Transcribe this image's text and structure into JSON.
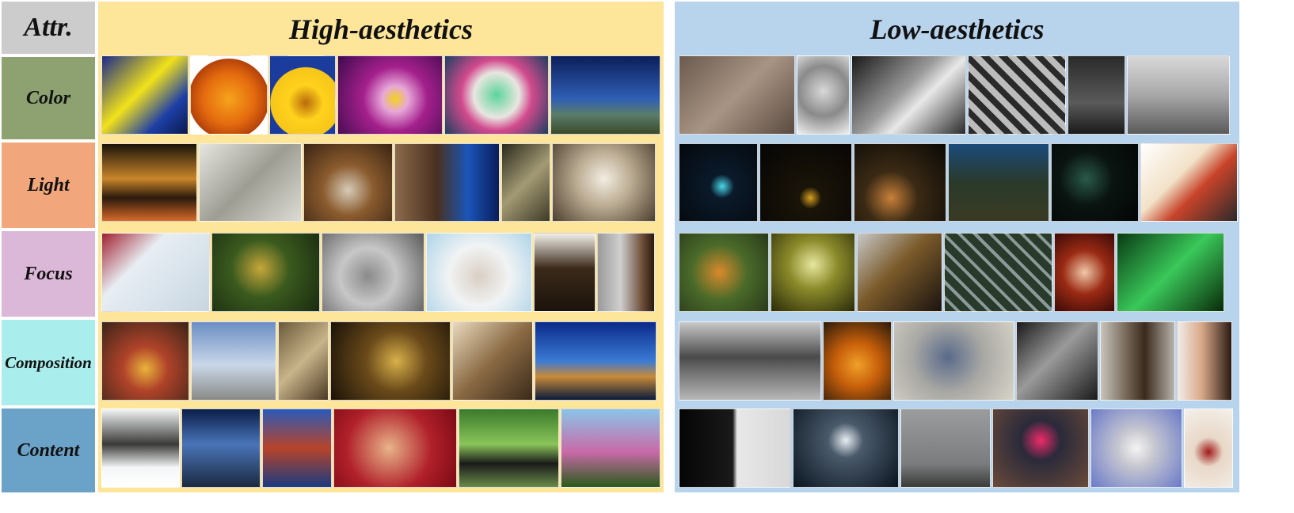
{
  "corner_label": "Attr.",
  "columns": {
    "high": {
      "title": "High-aesthetics",
      "bg": "#fde59a"
    },
    "low": {
      "title": "Low-aesthetics",
      "bg": "#b8d4ec"
    }
  },
  "rows": [
    {
      "label": "Color",
      "bg": "#8da171"
    },
    {
      "label": "Light",
      "bg": "#f2a67b"
    },
    {
      "label": "Focus",
      "bg": "#dbb7d8"
    },
    {
      "label": "Composition",
      "bg": "#a9eeec"
    },
    {
      "label": "Content",
      "bg": "#6ba2c7"
    }
  ],
  "photos": {
    "high": [
      [
        {
          "name": "abstract-swirl-photo",
          "fill": "linear-gradient(135deg,#1a2a8a 0%,#f2e21a 45%,#1d3fa6 75%,#0b1a4d 100%)"
        },
        {
          "name": "orange-flower-photo",
          "fill": "radial-gradient(circle at 50% 55%,#f6a41b 0%,#e46a0e 45%,#b4420a 70%,#ffffff 71%)"
        },
        {
          "name": "yellow-daisy-photo",
          "fill": "radial-gradient(circle at 55% 60%,#b86a0b 0%,#ffd21c 30%,#f6c51a 60%,#1b3c9c 61%)"
        },
        {
          "name": "purple-pansy-photo",
          "fill": "radial-gradient(circle at 55% 55%,#f3d21d 0%,#e7a7d9 18%,#a4208c 45%,#3d0b4d 100%)"
        },
        {
          "name": "paper-roll-photo",
          "fill": "radial-gradient(circle at 50% 50%,#5bd49a 0%,#e8e6e0 35%,#d24a8d 55%,#1d3f61 100%)"
        },
        {
          "name": "night-lake-boat-photo",
          "fill": "linear-gradient(180deg,#0b1e5a 0%,#2f5fb5 55%,#5a7d6b 75%,#3c4a2a 100%)"
        }
      ],
      [
        {
          "name": "night-riverwalk-photo",
          "fill": "linear-gradient(180deg,#1a1409 0%,#c9852b 45%,#2a1a0c 70%,#d76a2a 100%)"
        },
        {
          "name": "keyboard-key-photo",
          "fill": "linear-gradient(135deg,#e6e6e0 0%,#9d9d94 50%,#dcdcd4 100%)"
        },
        {
          "name": "shells-on-sand-photo",
          "fill": "radial-gradient(circle at 50% 60%,#d6cbb8 0%,#8a5b2e 40%,#3a2413 100%)"
        },
        {
          "name": "curved-building-photo",
          "fill": "linear-gradient(90deg,#8a6a4a 0%,#4a3020 40%,#1b55b8 70%,#0a1d5a 100%)"
        },
        {
          "name": "staircase-photo",
          "fill": "linear-gradient(135deg,#2a2a1c 0%,#a39a74 50%,#3d3a28 100%)"
        },
        {
          "name": "feather-photo",
          "fill": "radial-gradient(circle at 50% 45%,#f2ede2 0%,#bdae95 40%,#4d3f2e 100%)"
        }
      ],
      [
        {
          "name": "snowman-toy-photo",
          "fill": "linear-gradient(135deg,#a02030 0%,#e7eef3 35%,#c8d6e0 100%)"
        },
        {
          "name": "spiky-plant-photo",
          "fill": "radial-gradient(circle at 45% 45%,#c6a73a 0%,#3a5a1e 40%,#1a2a10 100%)"
        },
        {
          "name": "pigeon-photo",
          "fill": "radial-gradient(circle at 45% 55%,#8a8a8a 0%,#c7c7c7 40%,#5a5a5a 100%)"
        },
        {
          "name": "hamster-in-cup-photo",
          "fill": "radial-gradient(circle at 50% 55%,#d9cfc4 0%,#f1f3f4 45%,#aed4e8 100%)"
        },
        {
          "name": "bald-eagle-photo",
          "fill": "linear-gradient(180deg,#f2f0ea 0%,#3b2a1a 45%,#1a120a 100%)"
        },
        {
          "name": "boy-portrait-photo",
          "fill": "linear-gradient(90deg,#9a9a9a 0%,#cfcfcf 40%,#6a4a34 80%,#2a1a10 100%)"
        }
      ],
      [
        {
          "name": "fruit-still-life-photo",
          "fill": "radial-gradient(circle at 50% 60%,#e9b43a 0%,#b0432a 35%,#3a2418 100%)"
        },
        {
          "name": "tower-bridge-photo",
          "fill": "linear-gradient(180deg,#6b8ec4 0%,#c9d7e8 55%,#8a8a86 100%)"
        },
        {
          "name": "antique-shop-photo",
          "fill": "linear-gradient(135deg,#6a5a3a 0%,#c8b48a 50%,#4a3a24 100%)"
        },
        {
          "name": "wine-bottle-photo",
          "fill": "radial-gradient(circle at 55% 50%,#d8b04a 0%,#6a4a1a 40%,#1a1208 100%)"
        },
        {
          "name": "woman-at-typewriter-photo",
          "fill": "linear-gradient(135deg,#e8d9bd 0%,#8a6a44 50%,#3a2a1a 100%)"
        },
        {
          "name": "city-skyline-water-photo",
          "fill": "linear-gradient(180deg,#0b2a8a 0%,#3a7ad4 50%,#c78a3a 70%,#0a1a3a 100%)"
        }
      ],
      [
        {
          "name": "snowy-trees-photo",
          "fill": "linear-gradient(180deg,#f2f4f5 0%,#3a3a38 45%,#f4f6f7 75%,#ffffff 100%)"
        },
        {
          "name": "millennium-bridge-photo",
          "fill": "linear-gradient(180deg,#0a1e4a 0%,#4a74b8 45%,#1a2a40 100%)"
        },
        {
          "name": "red-fortress-photo",
          "fill": "linear-gradient(180deg,#2a5ab8 0%,#b8442a 50%,#1a3a80 100%)"
        },
        {
          "name": "smiling-woman-photo",
          "fill": "radial-gradient(circle at 45% 50%,#e8b48a 0%,#b0202a 55%,#7a0a14 100%)"
        },
        {
          "name": "jeep-photo",
          "fill": "linear-gradient(180deg,#3a7a2a 0%,#8ac45a 45%,#1a1a1a 70%,#6a8a4a 100%)"
        },
        {
          "name": "blossom-branch-photo",
          "fill": "linear-gradient(180deg,#8ac4e8 0%,#c86aa8 55%,#2a5a1a 100%)"
        }
      ]
    ],
    "low": [
      [
        {
          "name": "dim-bedroom-photo",
          "fill": "linear-gradient(135deg,#6a5a4e 0%,#a89484 50%,#5a4a40 100%)"
        },
        {
          "name": "raised-fist-photo",
          "fill": "radial-gradient(circle at 50% 45%,#d8d8d8 0%,#8a8a8a 50%,#f0f0f0 100%)"
        },
        {
          "name": "waterfall-bw-photo",
          "fill": "linear-gradient(135deg,#1a1a1a 0%,#9a9a9a 45%,#e8e8e8 60%,#2a2a2a 100%)"
        },
        {
          "name": "building-facade-photo",
          "fill": "repeating-linear-gradient(45deg,#2a2a2a 0 8px,#bcbcbc 8px 16px)"
        },
        {
          "name": "dark-skateboarder-photo",
          "fill": "linear-gradient(180deg,#2a2a2a 0%,#5a5a5a 60%,#1a1a1a 100%)"
        },
        {
          "name": "jumping-girl-bw-photo",
          "fill": "linear-gradient(180deg,#d8d8d8 0%,#a8a8a8 50%,#5a5a5a 100%)"
        }
      ],
      [
        {
          "name": "night-street-light-photo",
          "fill": "radial-gradient(circle at 55% 55%,#4ad8e8 0%,#0a1a2a 20%,#05080c 100%)"
        },
        {
          "name": "dark-sign-photo",
          "fill": "radial-gradient(circle at 55% 70%,#d8a020 0%,#1a1408 15%,#050505 100%)"
        },
        {
          "name": "dim-night-town-photo",
          "fill": "radial-gradient(circle at 40% 70%,#c8803a 0%,#3a2a14 35%,#0a0806 100%)"
        },
        {
          "name": "ghost-figure-field-photo",
          "fill": "linear-gradient(180deg,#1a4a7a 0%,#2a3a2a 50%,#3a3a24 100%)"
        },
        {
          "name": "dark-cat-photo",
          "fill": "radial-gradient(circle at 40% 45%,#2a5a4a 0%,#0a1410 40%,#030505 100%)"
        },
        {
          "name": "overexposed-car-photo",
          "fill": "linear-gradient(135deg,#ffffff 0%,#f2e2c8 40%,#c8442a 60%,#2a2a2a 100%)"
        }
      ],
      [
        {
          "name": "blurry-foliage-photo",
          "fill": "radial-gradient(circle at 45% 50%,#d88a2a 0%,#4a6a2a 45%,#2a3a1a 100%)"
        },
        {
          "name": "blurry-hallway-photo",
          "fill": "radial-gradient(circle at 50% 40%,#e8e8a0 0%,#8a8a2a 40%,#2a2a0a 100%)"
        },
        {
          "name": "messy-desk-photo",
          "fill": "linear-gradient(135deg,#c8c8c8 0%,#7a5a2a 45%,#1a1410 100%)"
        },
        {
          "name": "blurry-fence-photo",
          "fill": "repeating-linear-gradient(45deg,#2a3a2a 0 10px,#8a9a9a 10px 14px)"
        },
        {
          "name": "blurry-red-hair-photo",
          "fill": "radial-gradient(circle at 50% 50%,#f0c8a8 0%,#9a2a14 45%,#3a0a08 100%)"
        },
        {
          "name": "blurry-green-light-photo",
          "fill": "linear-gradient(135deg,#0a3a14 0%,#3ac85a 50%,#0a2a0a 100%)"
        }
      ],
      [
        {
          "name": "car-tire-photo",
          "fill": "linear-gradient(180deg,#c8c8c8 0%,#4a4a4a 45%,#b8b8b8 100%)"
        },
        {
          "name": "carved-pumpkin-photo",
          "fill": "radial-gradient(circle at 50% 55%,#f0a02a 0%,#c8600a 40%,#2a1a0a 100%)"
        },
        {
          "name": "pigeon-on-pavement-photo",
          "fill": "radial-gradient(circle at 45% 45%,#5a6a8a 0%,#a8a8a4 45%,#d8d4c8 100%)"
        },
        {
          "name": "tilted-skater-photo",
          "fill": "linear-gradient(135deg,#1a1a1a 0%,#9a9a9a 45%,#1a1a1a 100%)"
        },
        {
          "name": "tree-burl-photo",
          "fill": "linear-gradient(90deg,#c8c4bc 0%,#6a5a4a 40%,#3a2a1e 60%,#b8b4ac 100%)"
        },
        {
          "name": "cropped-face-photo",
          "fill": "linear-gradient(90deg,#f2ece6 0%,#d8a888 45%,#2a1a14 100%)"
        }
      ],
      [
        {
          "name": "half-face-bw-photo",
          "fill": "linear-gradient(90deg,#050505 0%,#1a1a1a 48%,#e8e8e8 52%,#d8d8d8 100%)"
        },
        {
          "name": "dark-box-photo",
          "fill": "radial-gradient(circle at 50% 40%,#e8eef4 0%,#4a5a6a 25%,#0a1420 100%)"
        },
        {
          "name": "foggy-field-photo",
          "fill": "linear-gradient(180deg,#9a9c9e 0%,#7a7c7e 70%,#3a3c3a 100%)"
        },
        {
          "name": "alarm-clock-photo",
          "fill": "radial-gradient(circle at 50% 40%,#f02a6a 0%,#2a2a3a 30%,#6a4a3a 100%)"
        },
        {
          "name": "toilet-paper-photo",
          "fill": "radial-gradient(circle at 50% 50%,#f4f4f4 0%,#c8c8d0 30%,#6a7ac8 100%)"
        },
        {
          "name": "cup-closeup-photo",
          "fill": "radial-gradient(circle at 50% 55%,#a01a1a 0%,#e8d8c8 30%,#f4f0ea 100%)"
        }
      ]
    ]
  }
}
